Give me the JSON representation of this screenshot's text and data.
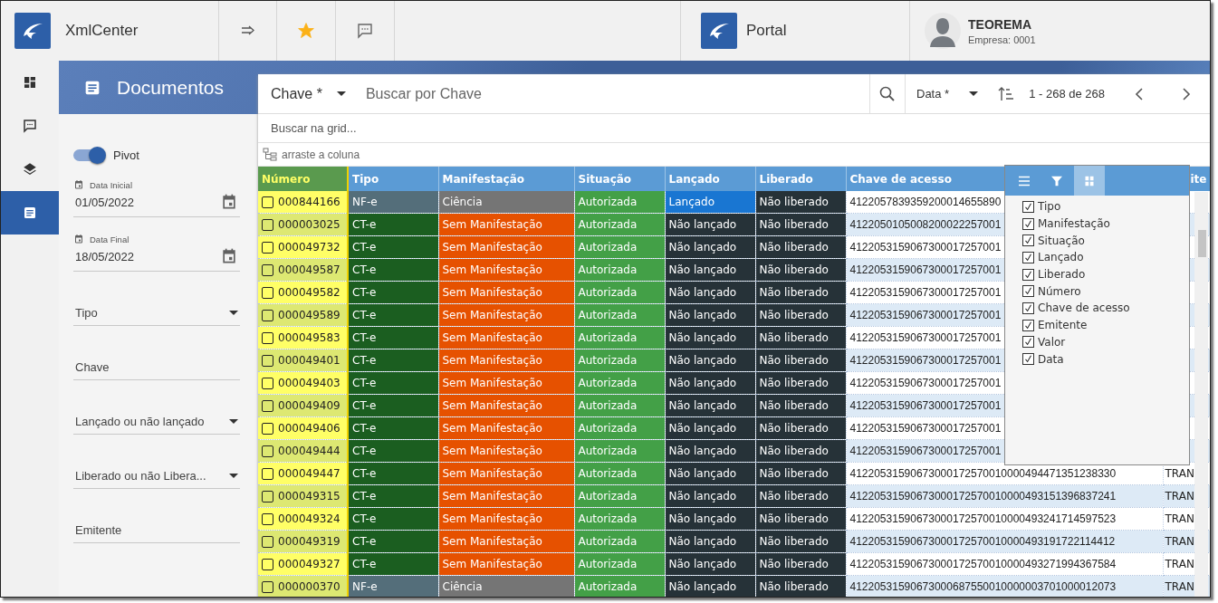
{
  "app": {
    "title": "XmlCenter",
    "favorite": true
  },
  "portal": {
    "title": "Portal"
  },
  "user": {
    "name": "TEOREMA",
    "company": "Empresa: 0001"
  },
  "nav_items": [
    {
      "kind": "dashboard",
      "selected": false
    },
    {
      "kind": "chat",
      "selected": false
    },
    {
      "kind": "layers",
      "selected": false
    },
    {
      "kind": "document",
      "selected": true
    }
  ],
  "page": {
    "title": "Documentos"
  },
  "filters": {
    "pivot": {
      "label": "Pivot",
      "on": true
    },
    "fields": [
      {
        "kind": "date",
        "label": "Data Inicial",
        "value": "01/05/2022"
      },
      {
        "kind": "date",
        "label": "Data Final",
        "value": "18/05/2022"
      },
      {
        "kind": "select",
        "placeholder": "Tipo"
      },
      {
        "kind": "text",
        "placeholder": "Chave"
      },
      {
        "kind": "select",
        "placeholder": "Lançado ou não lançado"
      },
      {
        "kind": "select",
        "placeholder": "Liberado ou não Libera..."
      },
      {
        "kind": "text",
        "placeholder": "Emitente"
      }
    ]
  },
  "search": {
    "field_selector": "Chave *",
    "placeholder": "Buscar por Chave",
    "sort_selector": "Data *",
    "pagination": "1 - 268 de 268"
  },
  "grid": {
    "filter_placeholder": "Buscar na grid...",
    "group_hint": "arraste a coluna",
    "columns": [
      "Número",
      "Tipo",
      "Manifestação",
      "Situação",
      "Lançado",
      "Liberado",
      "Chave de acesso",
      "ite"
    ],
    "rows": [
      {
        "numero": "000844166",
        "checked": false,
        "tipo": {
          "text": "NF-e",
          "color": "#546e7a"
        },
        "manifestacao": {
          "text": "Ciência",
          "color": "#757575"
        },
        "situacao": {
          "text": "Autorizada",
          "color": "#43a047"
        },
        "lancado": {
          "text": "Lançado",
          "color": "#1976d2"
        },
        "liberado": {
          "text": "Não liberado",
          "color": "#263238"
        },
        "chave": "4122057839359200014655890"
      },
      {
        "numero": "000003025",
        "checked": false,
        "tipo": {
          "text": "CT-e",
          "color": "#1b5e20"
        },
        "manifestacao": {
          "text": "Sem Manifestação",
          "color": "#e65100"
        },
        "situacao": {
          "text": "Autorizada",
          "color": "#43a047"
        },
        "lancado": {
          "text": "Não lançado",
          "color": "#263238"
        },
        "liberado": {
          "text": "Não liberado",
          "color": "#263238"
        },
        "chave": "4122050105008200022257001"
      },
      {
        "numero": "000049732",
        "checked": false,
        "tipo": {
          "text": "CT-e",
          "color": "#1b5e20"
        },
        "manifestacao": {
          "text": "Sem Manifestação",
          "color": "#e65100"
        },
        "situacao": {
          "text": "Autorizada",
          "color": "#43a047"
        },
        "lancado": {
          "text": "Não lançado",
          "color": "#263238"
        },
        "liberado": {
          "text": "Não liberado",
          "color": "#263238"
        },
        "chave": "4122053159067300017257001"
      },
      {
        "numero": "000049587",
        "checked": false,
        "tipo": {
          "text": "CT-e",
          "color": "#1b5e20"
        },
        "manifestacao": {
          "text": "Sem Manifestação",
          "color": "#e65100"
        },
        "situacao": {
          "text": "Autorizada",
          "color": "#43a047"
        },
        "lancado": {
          "text": "Não lançado",
          "color": "#263238"
        },
        "liberado": {
          "text": "Não liberado",
          "color": "#263238"
        },
        "chave": "4122053159067300017257001"
      },
      {
        "numero": "000049582",
        "checked": false,
        "tipo": {
          "text": "CT-e",
          "color": "#1b5e20"
        },
        "manifestacao": {
          "text": "Sem Manifestação",
          "color": "#e65100"
        },
        "situacao": {
          "text": "Autorizada",
          "color": "#43a047"
        },
        "lancado": {
          "text": "Não lançado",
          "color": "#263238"
        },
        "liberado": {
          "text": "Não liberado",
          "color": "#263238"
        },
        "chave": "4122053159067300017257001"
      },
      {
        "numero": "000049589",
        "checked": false,
        "tipo": {
          "text": "CT-e",
          "color": "#1b5e20"
        },
        "manifestacao": {
          "text": "Sem Manifestação",
          "color": "#e65100"
        },
        "situacao": {
          "text": "Autorizada",
          "color": "#43a047"
        },
        "lancado": {
          "text": "Não lançado",
          "color": "#263238"
        },
        "liberado": {
          "text": "Não liberado",
          "color": "#263238"
        },
        "chave": "4122053159067300017257001"
      },
      {
        "numero": "000049583",
        "checked": false,
        "tipo": {
          "text": "CT-e",
          "color": "#1b5e20"
        },
        "manifestacao": {
          "text": "Sem Manifestação",
          "color": "#e65100"
        },
        "situacao": {
          "text": "Autorizada",
          "color": "#43a047"
        },
        "lancado": {
          "text": "Não lançado",
          "color": "#263238"
        },
        "liberado": {
          "text": "Não liberado",
          "color": "#263238"
        },
        "chave": "4122053159067300017257001"
      },
      {
        "numero": "000049401",
        "checked": false,
        "tipo": {
          "text": "CT-e",
          "color": "#1b5e20"
        },
        "manifestacao": {
          "text": "Sem Manifestação",
          "color": "#e65100"
        },
        "situacao": {
          "text": "Autorizada",
          "color": "#43a047"
        },
        "lancado": {
          "text": "Não lançado",
          "color": "#263238"
        },
        "liberado": {
          "text": "Não liberado",
          "color": "#263238"
        },
        "chave": "4122053159067300017257001"
      },
      {
        "numero": "000049403",
        "checked": false,
        "tipo": {
          "text": "CT-e",
          "color": "#1b5e20"
        },
        "manifestacao": {
          "text": "Sem Manifestação",
          "color": "#e65100"
        },
        "situacao": {
          "text": "Autorizada",
          "color": "#43a047"
        },
        "lancado": {
          "text": "Não lançado",
          "color": "#263238"
        },
        "liberado": {
          "text": "Não liberado",
          "color": "#263238"
        },
        "chave": "4122053159067300017257001"
      },
      {
        "numero": "000049409",
        "checked": false,
        "tipo": {
          "text": "CT-e",
          "color": "#1b5e20"
        },
        "manifestacao": {
          "text": "Sem Manifestação",
          "color": "#e65100"
        },
        "situacao": {
          "text": "Autorizada",
          "color": "#43a047"
        },
        "lancado": {
          "text": "Não lançado",
          "color": "#263238"
        },
        "liberado": {
          "text": "Não liberado",
          "color": "#263238"
        },
        "chave": "4122053159067300017257001"
      },
      {
        "numero": "000049406",
        "checked": false,
        "tipo": {
          "text": "CT-e",
          "color": "#1b5e20"
        },
        "manifestacao": {
          "text": "Sem Manifestação",
          "color": "#e65100"
        },
        "situacao": {
          "text": "Autorizada",
          "color": "#43a047"
        },
        "lancado": {
          "text": "Não lançado",
          "color": "#263238"
        },
        "liberado": {
          "text": "Não liberado",
          "color": "#263238"
        },
        "chave": "4122053159067300017257001"
      },
      {
        "numero": "000049444",
        "checked": false,
        "tipo": {
          "text": "CT-e",
          "color": "#1b5e20"
        },
        "manifestacao": {
          "text": "Sem Manifestação",
          "color": "#e65100"
        },
        "situacao": {
          "text": "Autorizada",
          "color": "#43a047"
        },
        "lancado": {
          "text": "Não lançado",
          "color": "#263238"
        },
        "liberado": {
          "text": "Não liberado",
          "color": "#263238"
        },
        "chave": "4122053159067300017257001"
      },
      {
        "numero": "000049447",
        "checked": false,
        "tipo": {
          "text": "CT-e",
          "color": "#1b5e20"
        },
        "manifestacao": {
          "text": "Sem Manifestação",
          "color": "#e65100"
        },
        "situacao": {
          "text": "Autorizada",
          "color": "#43a047"
        },
        "lancado": {
          "text": "Não lançado",
          "color": "#263238"
        },
        "liberado": {
          "text": "Não liberado",
          "color": "#263238"
        },
        "chave": "41220531590673000172570010000494471351238330",
        "emitente": "TRAN"
      },
      {
        "numero": "000049315",
        "checked": false,
        "tipo": {
          "text": "CT-e",
          "color": "#1b5e20"
        },
        "manifestacao": {
          "text": "Sem Manifestação",
          "color": "#e65100"
        },
        "situacao": {
          "text": "Autorizada",
          "color": "#43a047"
        },
        "lancado": {
          "text": "Não lançado",
          "color": "#263238"
        },
        "liberado": {
          "text": "Não liberado",
          "color": "#263238"
        },
        "chave": "41220531590673000172570010000493151396837241",
        "emitente": "TRAN"
      },
      {
        "numero": "000049324",
        "checked": false,
        "tipo": {
          "text": "CT-e",
          "color": "#1b5e20"
        },
        "manifestacao": {
          "text": "Sem Manifestação",
          "color": "#e65100"
        },
        "situacao": {
          "text": "Autorizada",
          "color": "#43a047"
        },
        "lancado": {
          "text": "Não lançado",
          "color": "#263238"
        },
        "liberado": {
          "text": "Não liberado",
          "color": "#263238"
        },
        "chave": "41220531590673000172570010000493241714597523",
        "emitente": "TRAN"
      },
      {
        "numero": "000049319",
        "checked": false,
        "tipo": {
          "text": "CT-e",
          "color": "#1b5e20"
        },
        "manifestacao": {
          "text": "Sem Manifestação",
          "color": "#e65100"
        },
        "situacao": {
          "text": "Autorizada",
          "color": "#43a047"
        },
        "lancado": {
          "text": "Não lançado",
          "color": "#263238"
        },
        "liberado": {
          "text": "Não liberado",
          "color": "#263238"
        },
        "chave": "41220531590673000172570010000493191722114412",
        "emitente": "TRAN"
      },
      {
        "numero": "000049327",
        "checked": false,
        "tipo": {
          "text": "CT-e",
          "color": "#1b5e20"
        },
        "manifestacao": {
          "text": "Sem Manifestação",
          "color": "#e65100"
        },
        "situacao": {
          "text": "Autorizada",
          "color": "#43a047"
        },
        "lancado": {
          "text": "Não lançado",
          "color": "#263238"
        },
        "liberado": {
          "text": "Não liberado",
          "color": "#263238"
        },
        "chave": "41220531590673000172570010000493271994367584",
        "emitente": "TRAN"
      },
      {
        "numero": "000000370",
        "checked": false,
        "tipo": {
          "text": "NF-e",
          "color": "#546e7a"
        },
        "manifestacao": {
          "text": "Ciência",
          "color": "#757575"
        },
        "situacao": {
          "text": "Autorizada",
          "color": "#43a047"
        },
        "lancado": {
          "text": "Não lançado",
          "color": "#263238"
        },
        "liberado": {
          "text": "Não liberado",
          "color": "#263238"
        },
        "chave": "41220531590673000687550010000003701000012073",
        "emitente": "TRAN"
      }
    ]
  },
  "column_chooser": {
    "tabs": [
      {
        "kind": "menu",
        "selected": false
      },
      {
        "kind": "filter",
        "selected": false
      },
      {
        "kind": "columns",
        "selected": true
      }
    ],
    "items": [
      {
        "label": "Tipo",
        "checked": true
      },
      {
        "label": "Manifestação",
        "checked": true
      },
      {
        "label": "Situação",
        "checked": true
      },
      {
        "label": "Lançado",
        "checked": true
      },
      {
        "label": "Liberado",
        "checked": true
      },
      {
        "label": "Número",
        "checked": true
      },
      {
        "label": "Chave de acesso",
        "checked": true
      },
      {
        "label": "Emitente",
        "checked": true
      },
      {
        "label": "Valor",
        "checked": true
      },
      {
        "label": "Data",
        "checked": true
      }
    ]
  }
}
